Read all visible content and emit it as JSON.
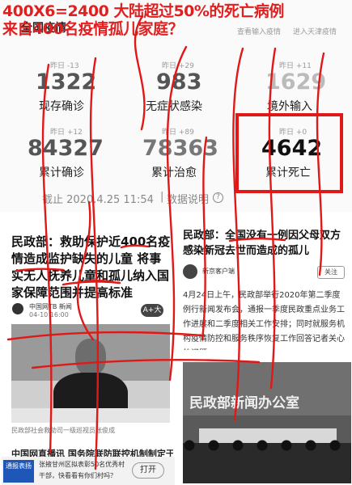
{
  "headline": {
    "line1": "400X6=2400 大陆超过50%的死亡病例",
    "line2": "来自400名疫情孤儿家庭？"
  },
  "panel": {
    "title": "全国疫情",
    "header_right": [
      "查看输入疫情",
      "进入天津疫情"
    ],
    "stats_row1": [
      {
        "delta": "昨日 -13",
        "value": "1322",
        "label": "现存确诊"
      },
      {
        "delta": "昨日 +29",
        "value": "983",
        "label": "无症状感染"
      },
      {
        "delta": "昨日 +11",
        "value": "1629",
        "label": "境外输入"
      }
    ],
    "stats_row2": [
      {
        "delta": "昨日 +12",
        "value": "84327",
        "label": "累计确诊"
      },
      {
        "delta": "昨日 +89",
        "value": "78363",
        "label": "累计治愈"
      },
      {
        "delta": "昨日 +0",
        "value": "4642",
        "label": "累计死亡"
      }
    ],
    "timestamp": "截止 2020.4.25 11:54",
    "data_note": "数据说明"
  },
  "left_card": {
    "headline": "民政部：救助保护近400名疫情造成监护缺失的儿童 将事实无人抚养儿童和孤儿纳入国家保障范围并提高标准",
    "source": "中国网TB 新闻",
    "date": "04-10 16:00",
    "badge": "A+大",
    "caption": "民政部社会救助司一级巡视员张俊成",
    "bottom_text": "中国网直播讯 国务院联防联控机制制定于4月"
  },
  "right_card": {
    "headline": "民政部：全国没有一例因父母双方感染新冠去世而造成的孤儿",
    "source": "新京客户端",
    "follow": "关注",
    "body": "4月24日上午，民政部举行2020年第二季度例行新闻发布会，通报一季度民政重点业务工作进展和二季度相关工作安排；同时就服务机构疫情防控和服务秩序恢复工作回答记者关心的问题。",
    "photo_banner": "民政部新闻办公室"
  },
  "ad_bar": {
    "tag": "通报表扬",
    "text": "张掖甘州区拟表彰50名优秀村干部，快看看有你们村吗？",
    "button": "打开"
  }
}
